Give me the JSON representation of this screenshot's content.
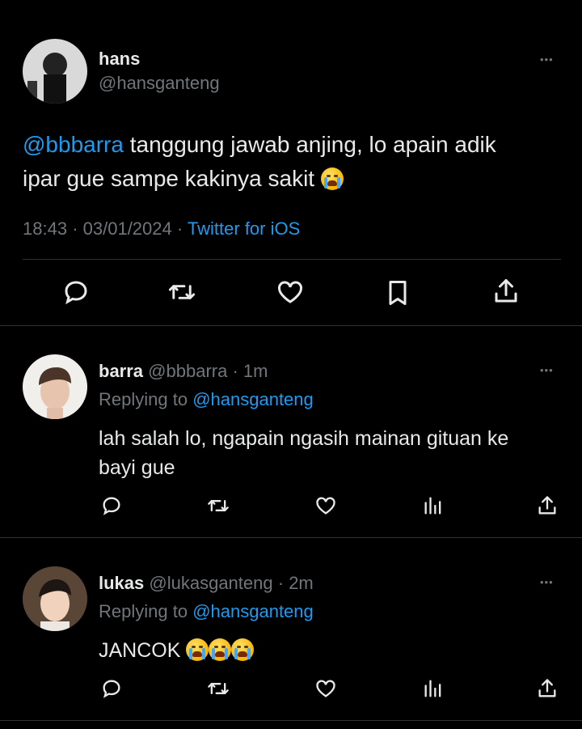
{
  "main_tweet": {
    "name": "hans",
    "handle": "@hansganteng",
    "mention": "@bbbarra",
    "text_line1": " tanggung jawab anjing, lo apain adik",
    "text_line2": "ipar gue sampe kakinya sakit",
    "emoji": "loudly-crying-face",
    "time": "18:43",
    "date": "03/01/2024",
    "separator": "·",
    "source": "Twitter for iOS"
  },
  "replies": [
    {
      "name": "barra",
      "handle": "@bbbarra",
      "age": "1m",
      "separator": "·",
      "replying_label": "Replying to",
      "replying_to": "@hansganteng",
      "text_line1": "lah salah lo, ngapain ngasih mainan gituan ke",
      "text_line2": "bayi gue"
    },
    {
      "name": "lukas",
      "handle": "@lukasganteng",
      "age": "2m",
      "separator": "·",
      "replying_label": "Replying to",
      "replying_to": "@hansganteng",
      "text_line1": "JANCOK",
      "emoji_count": 3
    }
  ],
  "more_glyph": "•••",
  "colors": {
    "background": "#000000",
    "text": "#e7e9ea",
    "muted": "#71767b",
    "accent": "#1d9bf0",
    "divider": "#2f3336"
  }
}
